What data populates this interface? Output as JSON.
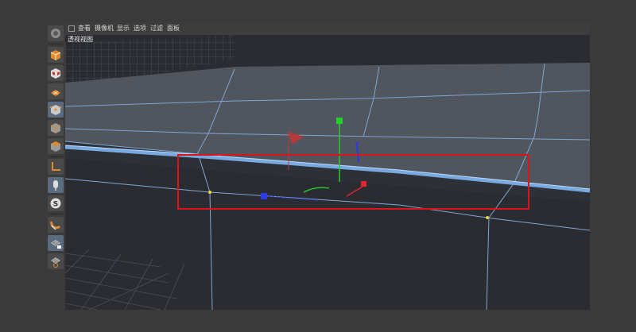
{
  "app": {
    "menu": [
      "查看",
      "摄像机",
      "显示",
      "选项",
      "过滤",
      "面板"
    ],
    "viewport_label": "透视视图"
  },
  "tools": [
    {
      "name": "view-manager-icon",
      "active": false
    },
    {
      "name": "model-mode-icon",
      "active": false
    },
    {
      "name": "texture-mode-icon",
      "active": false
    },
    {
      "name": "workplane-mode-icon",
      "active": false
    },
    {
      "name": "points-mode-icon",
      "active": true
    },
    {
      "name": "edges-mode-icon",
      "active": false
    },
    {
      "name": "polygons-mode-icon",
      "active": false
    },
    {
      "name": "axis-mode-icon",
      "active": false
    },
    {
      "name": "tweak-mode-icon",
      "active": true
    },
    {
      "name": "solo-mode-icon",
      "active": false
    },
    {
      "name": "snapping-icon",
      "active": false
    },
    {
      "name": "workplane-lock-icon",
      "active": true
    },
    {
      "name": "workplane-grid-icon",
      "active": false
    }
  ],
  "colors": {
    "background": "#3a3a3a",
    "viewport": "#2a2c31",
    "mesh_top": "#50555e",
    "mesh_front": "#2b2e33",
    "edge_highlight": "#78a9e0",
    "gizmo_x": "#e02530",
    "gizmo_y": "#22d129",
    "gizmo_z": "#2a39e8",
    "selection_box": "#d9141a",
    "point_selected": "#f0d430"
  }
}
